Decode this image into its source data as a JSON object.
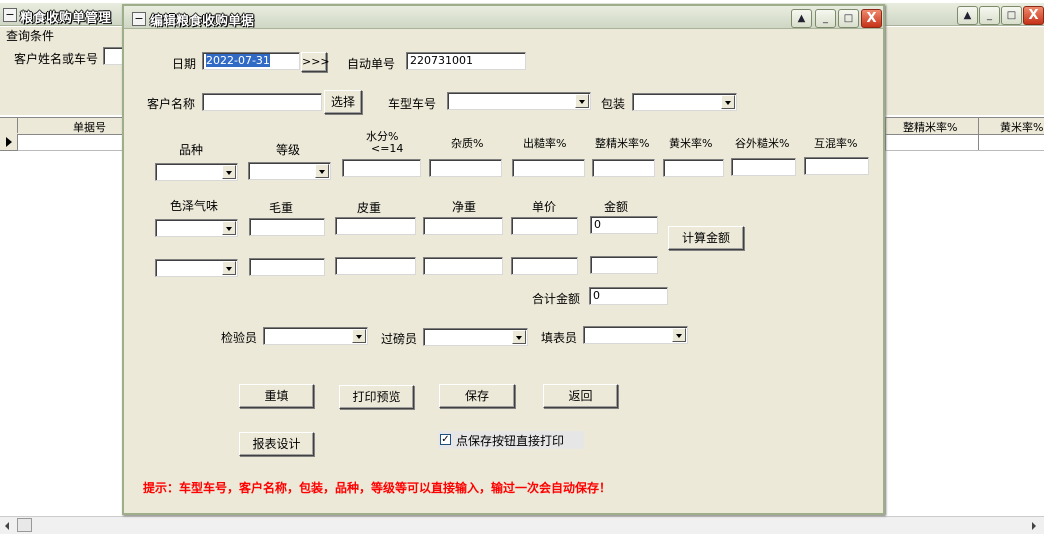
{
  "bg_window": {
    "title": "粮食收购单管理",
    "query_section": "查询条件",
    "customer_search_label": "客户姓名或车号",
    "grid_headers": {
      "left": "单据号",
      "right_1": "整精米率%",
      "right_2": "黄米率%"
    }
  },
  "dialog": {
    "title": "编辑粮食收购单据",
    "date_label": "日期",
    "date_value": "2022-07-31",
    "date_picker_label": ">>>",
    "auto_no_label": "自动单号",
    "auto_no_value": "220731001",
    "customer_label": "客户名称",
    "customer_value": "",
    "select_button": "选择",
    "vehicle_label": "车型车号",
    "packaging_label": "包装",
    "quality_headers": {
      "variety": "品种",
      "grade": "等级",
      "moisture": "水分%",
      "moisture_sub": "<=14",
      "impurity": "杂质%",
      "yield": "出糙率%",
      "whole_rice": "整精米率%",
      "yellow_rice": "黄米率%",
      "husk_rice": "谷外糙米%",
      "mixed": "互混率%"
    },
    "weight_headers": {
      "color_smell": "色泽气味",
      "gross": "毛重",
      "tare": "皮重",
      "net": "净重",
      "price": "单价",
      "amount": "金额"
    },
    "amount_row1": "0",
    "amount_row2": "",
    "calc_button": "计算金额",
    "total_label": "合计金额",
    "total_value": "0",
    "inspector_label": "检验员",
    "weigher_label": "过磅员",
    "filler_label": "填表员",
    "buttons": {
      "reset": "重填",
      "print_preview": "打印预览",
      "save": "保存",
      "back": "返回",
      "report_design": "报表设计"
    },
    "print_checkbox_label": "点保存按钮直接打印",
    "print_checkbox_checked": true,
    "hint": "提示：车型车号，客户名称，包装，品种，等级等可以直接输入，输过一次会自动保存！",
    "colors": {
      "hint": "#ff0000",
      "dialog_bg": "#ece9d8",
      "frame": "#9fae8a"
    }
  }
}
